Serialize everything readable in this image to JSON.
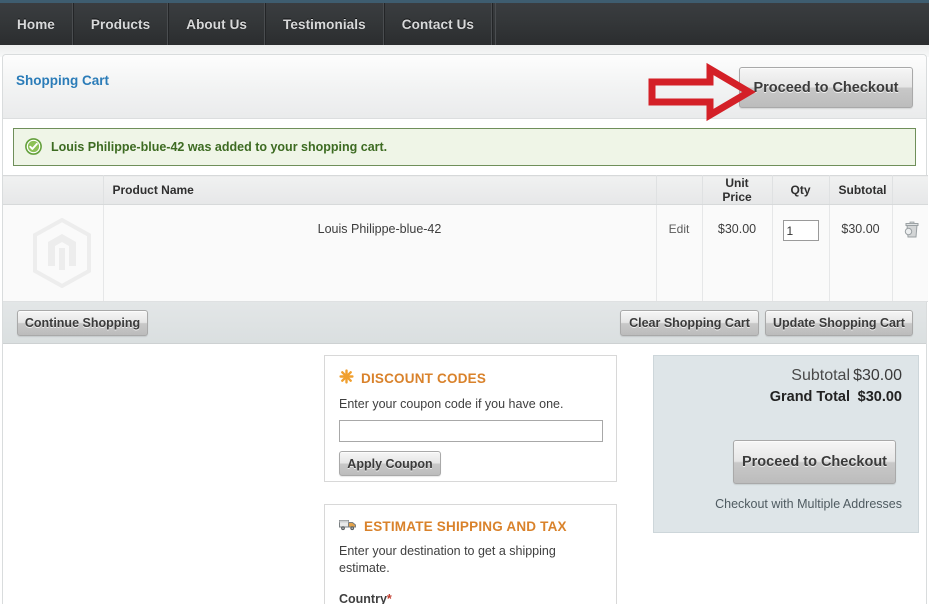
{
  "nav": {
    "items": [
      {
        "label": "Home"
      },
      {
        "label": "Products"
      },
      {
        "label": "About Us"
      },
      {
        "label": "Testimonials"
      },
      {
        "label": "Contact Us"
      }
    ]
  },
  "cart_header": {
    "title": "Shopping Cart",
    "checkout_button": "Proceed to Checkout"
  },
  "annotation": {
    "type": "arrow",
    "direction": "right",
    "color": "#d42027",
    "points_at": "Proceed to Checkout"
  },
  "message": {
    "icon": "success-check-icon",
    "text": "Louis Philippe-blue-42 was added to your shopping cart.",
    "background": "#eff5e7",
    "border_color": "#6f8f5a",
    "text_color": "#3d6b22"
  },
  "table": {
    "columns": [
      "",
      "Product Name",
      "",
      "Unit Price",
      "Qty",
      "Subtotal",
      ""
    ],
    "rows": [
      {
        "thumbnail": "magento-logo-placeholder",
        "product_name": "Louis Philippe-blue-42",
        "edit_label": "Edit",
        "unit_price": "$30.00",
        "qty": "1",
        "subtotal": "$30.00",
        "remove_icon": "trash-icon"
      }
    ]
  },
  "toolbar": {
    "continue_shopping": "Continue Shopping",
    "clear_cart": "Clear Shopping Cart",
    "update_cart": "Update Shopping Cart"
  },
  "discount": {
    "icon": "asterisk-icon",
    "title": "DISCOUNT CODES",
    "description": "Enter your coupon code if you have one.",
    "input_value": "",
    "input_placeholder": "",
    "apply_button": "Apply Coupon",
    "accent_color": "#d9822b"
  },
  "shipping": {
    "icon": "truck-icon",
    "title": "ESTIMATE SHIPPING AND TAX",
    "description": "Enter your destination to get a shipping estimate.",
    "country_label": "Country",
    "required_marker": "*",
    "accent_color": "#d9822b"
  },
  "totals": {
    "subtotal_label": "Subtotal",
    "subtotal_value": "$30.00",
    "grand_total_label": "Grand Total",
    "grand_total_value": "$30.00",
    "checkout_button": "Proceed to Checkout",
    "multiple_addresses_link": "Checkout with Multiple Addresses",
    "background": "#dee5e8"
  }
}
